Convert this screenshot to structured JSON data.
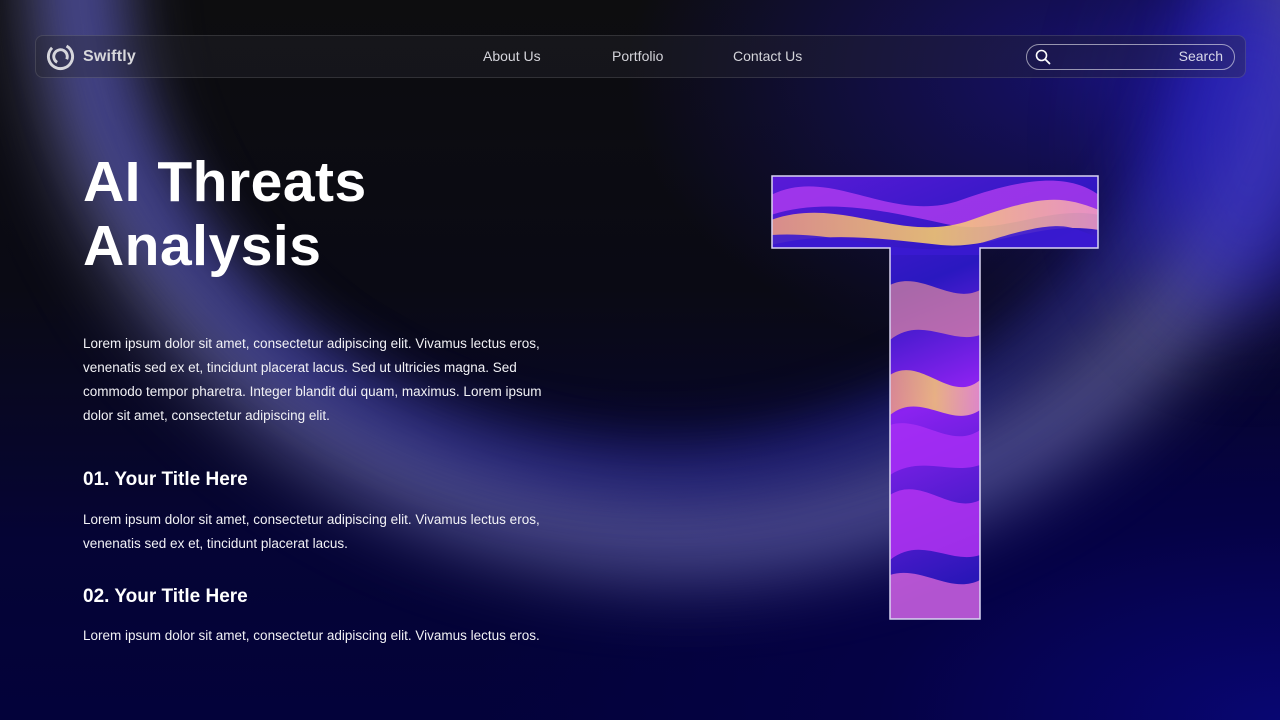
{
  "brand": {
    "name": "Swiftly",
    "logo_icon": "swirl-logo-icon"
  },
  "nav": {
    "items": [
      {
        "label": "About Us"
      },
      {
        "label": "Portfolio"
      },
      {
        "label": "Contact Us"
      }
    ]
  },
  "search": {
    "placeholder": "Search",
    "icon": "search-icon"
  },
  "hero": {
    "title_line1": "AI Threats",
    "title_line2": "Analysis",
    "intro": "Lorem ipsum dolor sit amet, consectetur adipiscing elit. Vivamus lectus eros, venenatis sed ex et, tincidunt placerat lacus. Sed ut ultricies magna. Sed commodo tempor pharetra. Integer blandit dui quam, maximus. Lorem ipsum dolor sit amet, consectetur adipiscing elit."
  },
  "sections": [
    {
      "title": "01. Your Title Here",
      "text": "Lorem ipsum dolor sit amet, consectetur adipiscing elit. Vivamus lectus eros, venenatis sed ex et, tincidunt placerat lacus."
    },
    {
      "title": "02. Your Title Here",
      "text": "Lorem ipsum dolor sit amet, consectetur adipiscing elit. Vivamus lectus eros."
    }
  ],
  "colors": {
    "background": "#0b0a12",
    "accent_blue": "#08066e",
    "accent_purple": "#9b28f0",
    "accent_gold": "#f5c56a",
    "text": "#ffffff"
  }
}
